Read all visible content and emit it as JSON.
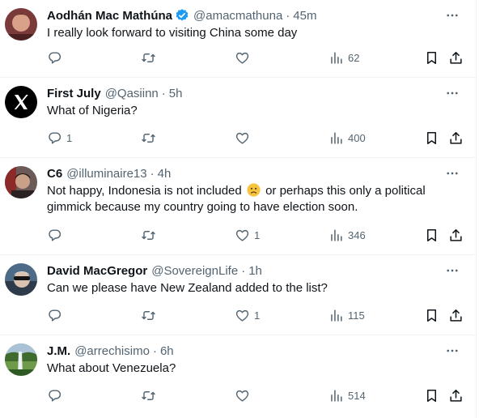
{
  "tweets": [
    {
      "name": "Aodhán Mac Mathúna",
      "verified": true,
      "handle": "@amacmathuna",
      "time": "45m",
      "text": "I really look forward to visiting China some day",
      "replies": "",
      "likes": "",
      "views": "62"
    },
    {
      "name": "First July",
      "verified": false,
      "handle": "@Qasiinn",
      "time": "5h",
      "text": "What of Nigeria?",
      "replies": "1",
      "likes": "",
      "views": "400"
    },
    {
      "name": "C6",
      "verified": false,
      "handle": "@illuminaire13",
      "time": "4h",
      "text_before_emoji": "Not happy, Indonesia is not included",
      "text_after_emoji": "or perhaps this only a political gimmick because my country going to have election soon.",
      "replies": "",
      "likes": "1",
      "views": "346"
    },
    {
      "name": "David MacGregor",
      "verified": false,
      "handle": "@SovereignLife",
      "time": "1h",
      "text": "Can we please have New Zealand added to the list?",
      "replies": "",
      "likes": "1",
      "views": "115"
    },
    {
      "name": "J.M.",
      "verified": false,
      "handle": "@arrechisimo",
      "time": "6h",
      "text": "What about Venezuela?",
      "replies": "",
      "likes": "",
      "views": "514"
    }
  ],
  "separator": "·",
  "icons": {
    "reply": "reply-icon",
    "retweet": "retweet-icon",
    "like": "like-icon",
    "views": "views-icon",
    "bookmark": "bookmark-icon",
    "share": "share-icon",
    "more": "more-icon",
    "verified": "verified-badge-icon",
    "emoji": "slightly-frowning-face-emoji"
  },
  "colors": {
    "text": "#0f1419",
    "secondary": "#536471",
    "verified": "#1d9bf0",
    "border": "#eff3f4"
  }
}
